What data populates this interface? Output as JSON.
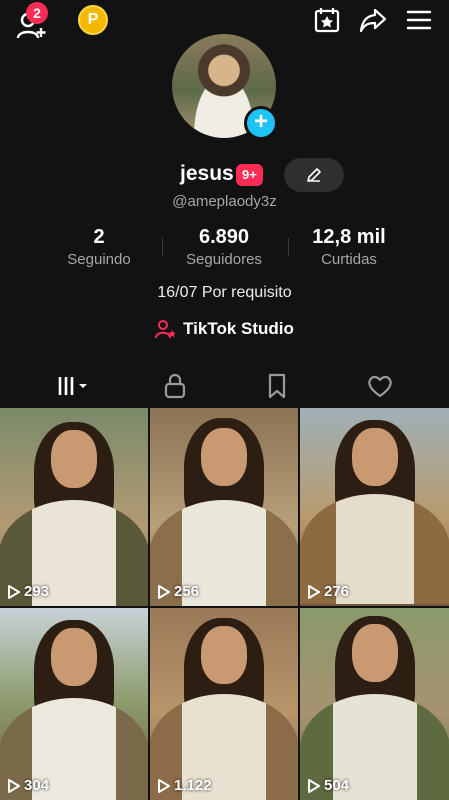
{
  "topbar": {
    "notification_count": "2",
    "coin_label": "P"
  },
  "profile": {
    "username": "jesus",
    "badge": "9+",
    "handle": "@ameplaody3z",
    "stats": [
      {
        "value": "2",
        "label": "Seguindo"
      },
      {
        "value": "6.890",
        "label": "Seguidores"
      },
      {
        "value": "12,8 mil",
        "label": "Curtidas"
      }
    ],
    "bio": "16/07 Por requisito",
    "studio_label": "TikTok Studio"
  },
  "videos": [
    {
      "views": "293"
    },
    {
      "views": "256"
    },
    {
      "views": "276"
    },
    {
      "views": "304"
    },
    {
      "views": "1.122"
    },
    {
      "views": "504"
    }
  ],
  "colors": {
    "accent_red": "#fe2c55",
    "accent_blue": "#20c4f4",
    "coin_gold": "#f5b800",
    "background": "#121212"
  }
}
